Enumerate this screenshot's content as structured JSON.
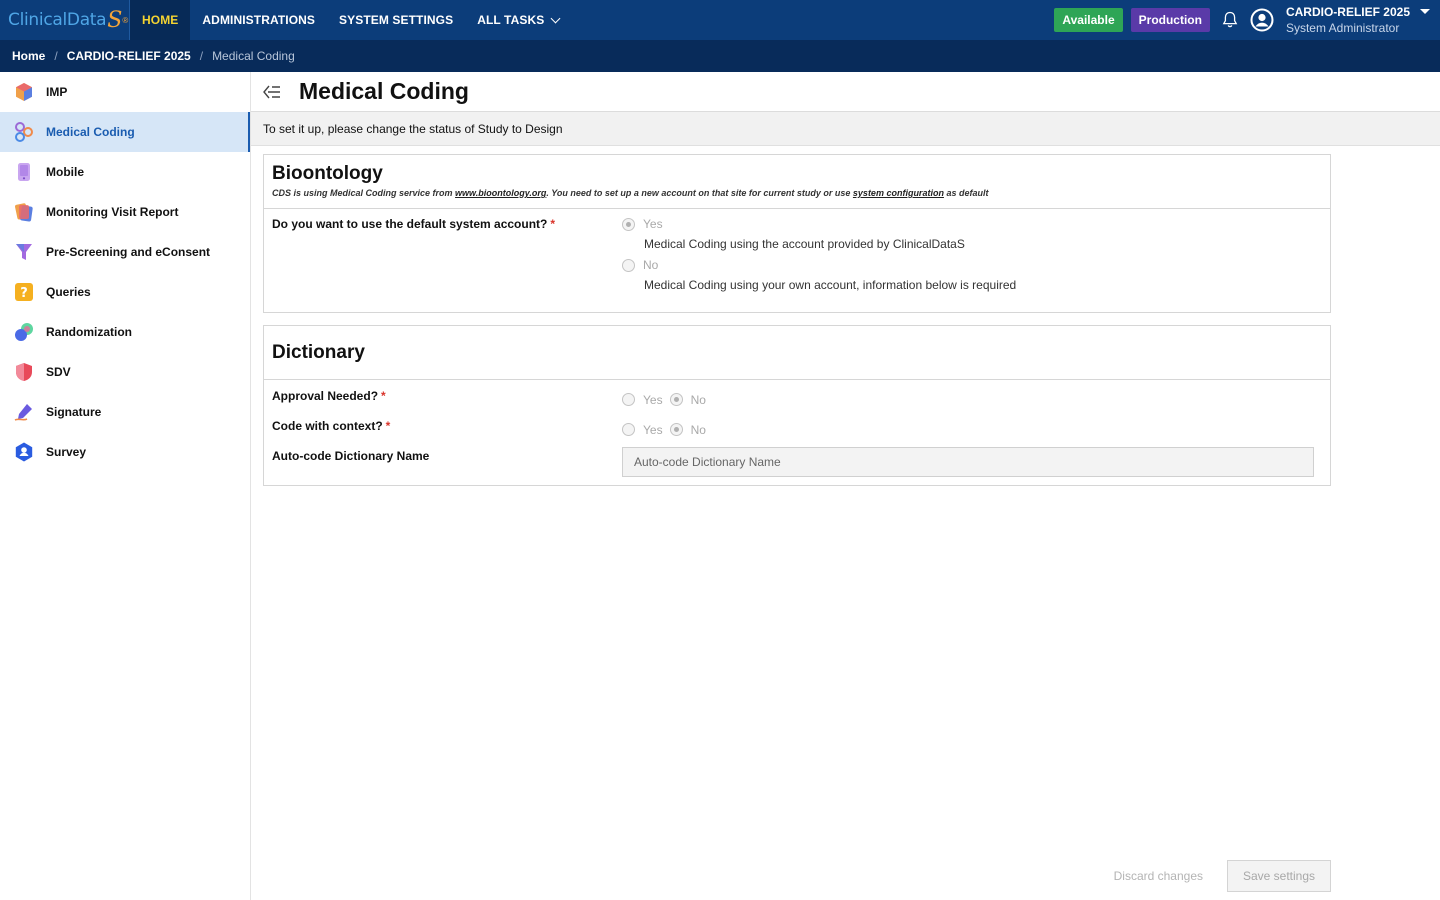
{
  "topbar": {
    "logo_text": "ClinicalData",
    "logo_mark": "S",
    "logo_reg": "®",
    "nav": [
      {
        "label": "HOME"
      },
      {
        "label": "ADMINISTRATIONS"
      },
      {
        "label": "SYSTEM SETTINGS"
      },
      {
        "label": "ALL TASKS"
      }
    ],
    "status_badge": "Available",
    "env_badge": "Production",
    "study_name": "CARDIO-RELIEF 2025",
    "user_role": "System Administrator",
    "icons": [
      "bell-icon",
      "account-icon",
      "caret-down-icon"
    ]
  },
  "breadcrumb": {
    "items": [
      "Home",
      "CARDIO-RELIEF 2025",
      "Medical Coding"
    ],
    "separator": "/"
  },
  "sidebar": {
    "items": [
      {
        "label": "IMP",
        "icon": "cube-icon"
      },
      {
        "label": "Medical Coding",
        "icon": "coding-icon",
        "active": true
      },
      {
        "label": "Mobile",
        "icon": "mobile-icon"
      },
      {
        "label": "Monitoring Visit Report",
        "icon": "report-icon"
      },
      {
        "label": "Pre-Screening and eConsent",
        "icon": "funnel-icon"
      },
      {
        "label": "Queries",
        "icon": "question-icon"
      },
      {
        "label": "Randomization",
        "icon": "randomization-icon"
      },
      {
        "label": "SDV",
        "icon": "shield-icon"
      },
      {
        "label": "Signature",
        "icon": "pen-icon"
      },
      {
        "label": "Survey",
        "icon": "survey-icon"
      }
    ]
  },
  "main": {
    "title": "Medical Coding",
    "notice": "To set it up, please change the status of Study to Design",
    "bioontology": {
      "title": "Bioontology",
      "desc_prefix": "CDS is using Medical Coding service from ",
      "desc_link": "www.bioontology.org",
      "desc_middle": ". You need to set up a new account on that site for current study or use ",
      "desc_link2": "system configuration",
      "desc_suffix": " as default",
      "question": "Do you want to use the default system account?",
      "required_mark": "*",
      "options": [
        {
          "label": "Yes",
          "desc": "Medical Coding using the account provided by ClinicalDataS",
          "checked": true
        },
        {
          "label": "No",
          "desc": "Medical Coding using your own account, information below is required",
          "checked": false
        }
      ]
    },
    "dictionary": {
      "title": "Dictionary",
      "approval_label": "Approval Needed?",
      "context_label": "Code with context?",
      "required_mark": "*",
      "yes_label": "Yes",
      "no_label": "No",
      "approval_value": "No",
      "context_value": "No",
      "autocode_label": "Auto-code Dictionary Name",
      "autocode_placeholder": "Auto-code Dictionary Name"
    },
    "buttons": {
      "discard": "Discard changes",
      "save": "Save settings"
    }
  }
}
